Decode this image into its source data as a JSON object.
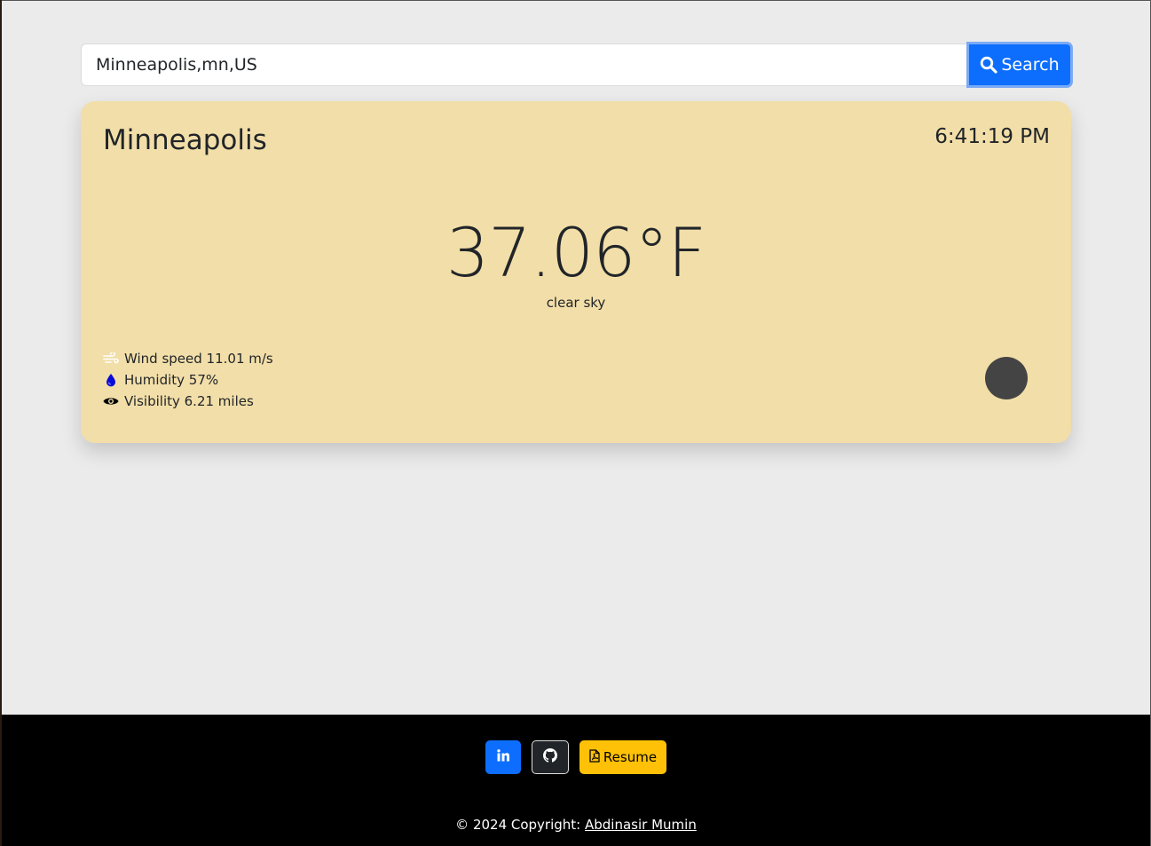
{
  "search": {
    "value": "Minneapolis,mn,US",
    "button_label": "Search",
    "button_icon": "search-icon"
  },
  "weather": {
    "city": "Minneapolis",
    "time": "6:41:19 PM",
    "temperature": "37.06°F",
    "description": "clear sky",
    "stats": [
      {
        "icon": "wind-icon",
        "text": "Wind speed 11.01 m/s"
      },
      {
        "icon": "droplet-icon",
        "text": "Humidity 57%"
      },
      {
        "icon": "eye-icon",
        "text": "Visibility 6.21 miles"
      }
    ],
    "icon": "weather-condition-icon"
  },
  "footer": {
    "linkedin_icon": "linkedin-icon",
    "github_icon": "github-icon",
    "resume_label": "Resume",
    "resume_icon": "pdf-file-icon",
    "copyright_text": "© 2024 Copyright: ",
    "author": "Abdinasir Mumin"
  },
  "colors": {
    "accent": "#0d6efd",
    "card": "#f2dea8",
    "background": "#ebebeb",
    "footer": "#000000",
    "resume": "#ffc107"
  }
}
